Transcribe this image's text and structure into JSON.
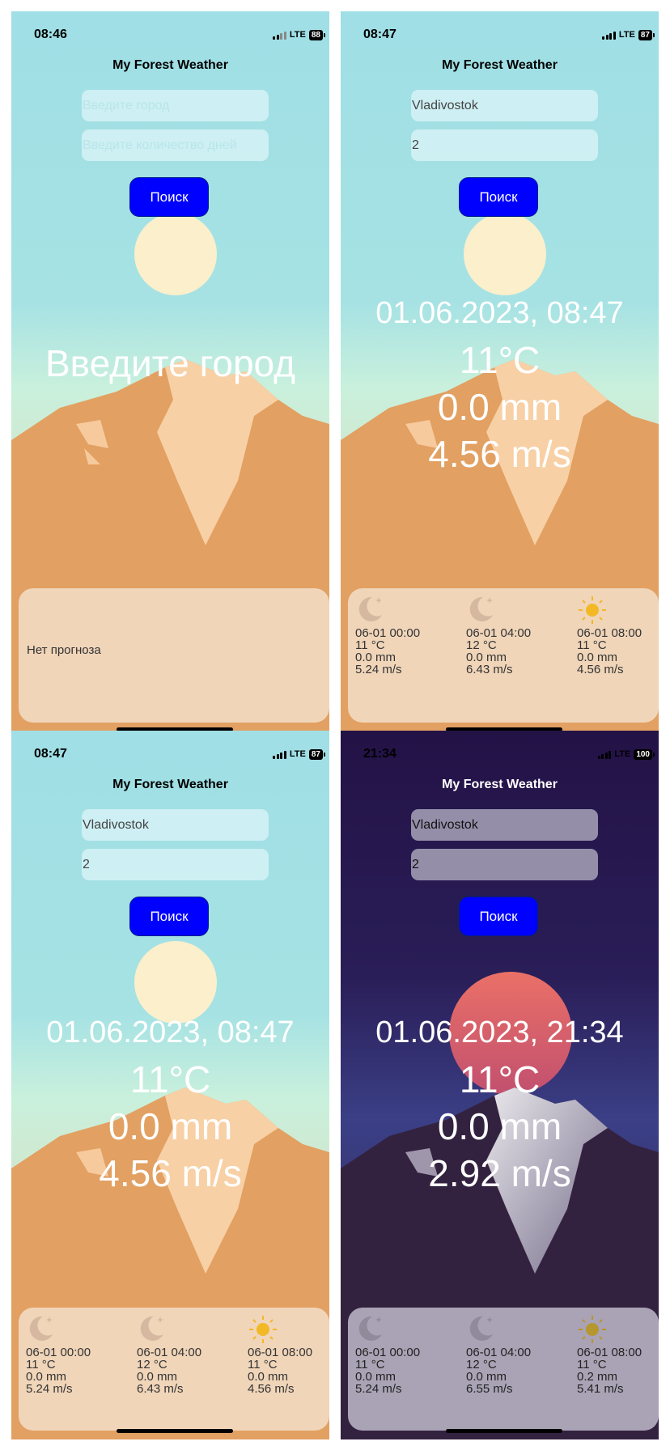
{
  "app_title": "My Forest Weather",
  "search_label": "Поиск",
  "panels": [
    {
      "time": "08:46",
      "network": "LTE",
      "battery": "88",
      "city_value": "",
      "city_placeholder": "Введите город",
      "days_value": "",
      "days_placeholder": "Введите количество дней",
      "message": "Введите город",
      "no_forecast": "Нет прогноза"
    },
    {
      "time": "08:47",
      "network": "LTE",
      "battery": "87",
      "city_value": "Vladivostok",
      "days_value": "2",
      "date": "01.06.2023, 08:47",
      "temp": "11°C",
      "rain": "0.0 mm",
      "wind": "4.56 m/s",
      "forecast": [
        {
          "icon": "moon-icon",
          "time": "06-01 00:00",
          "temp": "11 °C",
          "rain": "0.0  mm",
          "wind": "5.24  m/s"
        },
        {
          "icon": "moon-icon",
          "time": "06-01 04:00",
          "temp": "12 °C",
          "rain": "0.0  mm",
          "wind": "6.43  m/s"
        },
        {
          "icon": "sun-icon",
          "time": "06-01 08:00",
          "temp": "11 °C",
          "rain": "0.0  mm",
          "wind": "4.56  m/s"
        }
      ]
    },
    {
      "time": "08:47",
      "network": "LTE",
      "battery": "87",
      "city_value": "Vladivostok",
      "days_value": "2",
      "date": "01.06.2023, 08:47",
      "temp": "11°C",
      "rain": "0.0 mm",
      "wind": "4.56 m/s",
      "forecast": [
        {
          "icon": "moon-icon",
          "time": "06-01 00:00",
          "temp": "11 °C",
          "rain": "0.0  mm",
          "wind": "5.24  m/s"
        },
        {
          "icon": "moon-icon",
          "time": "06-01 04:00",
          "temp": "12 °C",
          "rain": "0.0  mm",
          "wind": "6.43  m/s"
        },
        {
          "icon": "sun-icon",
          "time": "06-01 08:00",
          "temp": "11 °C",
          "rain": "0.0  mm",
          "wind": "4.56  m/s"
        }
      ]
    },
    {
      "time": "21:34",
      "network": "LTE",
      "battery": "100",
      "city_value": "Vladivostok",
      "days_value": "2",
      "date": "01.06.2023, 21:34",
      "temp": "11°C",
      "rain": "0.0 mm",
      "wind": "2.92 m/s",
      "forecast": [
        {
          "icon": "moon-icon",
          "time": "06-01 00:00",
          "temp": "11 °C",
          "rain": "0.0  mm",
          "wind": "5.24  m/s"
        },
        {
          "icon": "moon-icon",
          "time": "06-01 04:00",
          "temp": "12 °C",
          "rain": "0.0  mm",
          "wind": "6.55  m/s"
        },
        {
          "icon": "sun-icon",
          "time": "06-01 08:00",
          "temp": "11 °C",
          "rain": "0.2  mm",
          "wind": "5.41  m/s"
        }
      ]
    }
  ],
  "colors": {
    "search_button": "#0000ff",
    "day_sun": "#fbefcc",
    "night_sun": "#e86d68",
    "mountain_day": "#e2a062",
    "mountain_night": "#33223f"
  }
}
